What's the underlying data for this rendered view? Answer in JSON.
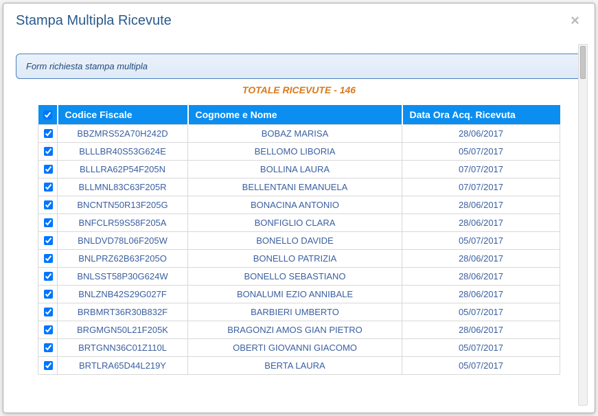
{
  "modal": {
    "title": "Stampa Multipla Ricevute",
    "close_label": "×"
  },
  "form_legend": "Form richiesta stampa multipla",
  "totale_label": "TOTALE RICEVUTE - 146",
  "table": {
    "headers": {
      "cf": "Codice Fiscale",
      "name": "Cognome e Nome",
      "date": "Data Ora Acq. Ricevuta"
    },
    "rows": [
      {
        "checked": true,
        "cf": "BBZMRS52A70H242D",
        "name": "BOBAZ MARISA",
        "date": "28/06/2017"
      },
      {
        "checked": true,
        "cf": "BLLLBR40S53G624E",
        "name": "BELLOMO LIBORIA",
        "date": "05/07/2017"
      },
      {
        "checked": true,
        "cf": "BLLLRA62P54F205N",
        "name": "BOLLINA LAURA",
        "date": "07/07/2017"
      },
      {
        "checked": true,
        "cf": "BLLMNL83C63F205R",
        "name": "BELLENTANI EMANUELA",
        "date": "07/07/2017"
      },
      {
        "checked": true,
        "cf": "BNCNTN50R13F205G",
        "name": "BONACINA ANTONIO",
        "date": "28/06/2017"
      },
      {
        "checked": true,
        "cf": "BNFCLR59S58F205A",
        "name": "BONFIGLIO CLARA",
        "date": "28/06/2017"
      },
      {
        "checked": true,
        "cf": "BNLDVD78L06F205W",
        "name": "BONELLO DAVIDE",
        "date": "05/07/2017"
      },
      {
        "checked": true,
        "cf": "BNLPRZ62B63F205O",
        "name": "BONELLO PATRIZIA",
        "date": "28/06/2017"
      },
      {
        "checked": true,
        "cf": "BNLSST58P30G624W",
        "name": "BONELLO SEBASTIANO",
        "date": "28/06/2017"
      },
      {
        "checked": true,
        "cf": "BNLZNB42S29G027F",
        "name": "BONALUMI EZIO ANNIBALE",
        "date": "28/06/2017"
      },
      {
        "checked": true,
        "cf": "BRBMRT36R30B832F",
        "name": "BARBIERI UMBERTO",
        "date": "05/07/2017"
      },
      {
        "checked": true,
        "cf": "BRGMGN50L21F205K",
        "name": "BRAGONZI AMOS GIAN PIETRO",
        "date": "28/06/2017"
      },
      {
        "checked": true,
        "cf": "BRTGNN36C01Z110L",
        "name": "OBERTI GIOVANNI GIACOMO",
        "date": "05/07/2017"
      },
      {
        "checked": true,
        "cf": "BRTLRA65D44L219Y",
        "name": "BERTA LAURA",
        "date": "05/07/2017"
      }
    ],
    "header_checked": true
  }
}
